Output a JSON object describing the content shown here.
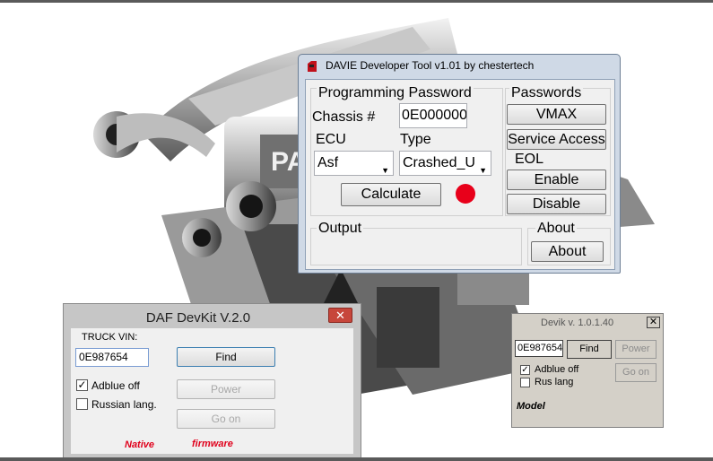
{
  "davie": {
    "title": "DAVIE Developer Tool v1.01 by chestertech",
    "programming_group": "Programming Password",
    "chassis_label": "Chassis #",
    "chassis_value": "0E000000",
    "ecu_label": "ECU",
    "ecu_value": "Asf",
    "type_label": "Type",
    "type_value": "Crashed_U",
    "calculate_label": "Calculate",
    "status_color": "#e8001a",
    "passwords_group": "Passwords",
    "vmax_label": "VMAX",
    "service_access_label": "Service Access",
    "eol_group": "EOL",
    "enable_label": "Enable",
    "disable_label": "Disable",
    "output_group": "Output",
    "about_group": "About",
    "about_button": "About"
  },
  "devkit": {
    "title": "DAF DevKit V.2.0",
    "vin_label": "TRUCK VIN:",
    "vin_value": "0E987654",
    "find_label": "Find",
    "power_label": "Power",
    "goon_label": "Go on",
    "adblue_label": "Adblue off",
    "adblue_checked": true,
    "russian_label": "Russian lang.",
    "russian_checked": false,
    "footer_left": "Native",
    "footer_right": "firmware",
    "footer_color": "#e0001b"
  },
  "devik": {
    "title": "Devik v. 1.0.1.40",
    "vin_value": "0E987654",
    "find_label": "Find",
    "power_label": "Power",
    "goon_label": "Go on",
    "adblue_label": "Adblue off",
    "adblue_checked": true,
    "rus_label": "Rus lang",
    "rus_checked": false,
    "model_label": "Model"
  }
}
